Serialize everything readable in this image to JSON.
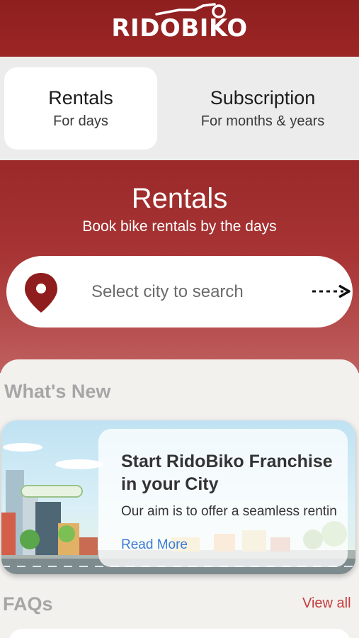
{
  "header": {
    "logo_text": "RIDOBIKO",
    "logo_icon": "motorbike-icon"
  },
  "tabs": [
    {
      "title": "Rentals",
      "subtitle": "For days",
      "active": true
    },
    {
      "title": "Subscription",
      "subtitle": "For months & years",
      "active": false
    }
  ],
  "hero": {
    "title": "Rentals",
    "subtitle": "Book bike rentals by the days",
    "search": {
      "placeholder": "Select city to search",
      "pin_icon": "location-pin-icon",
      "arrow_icon": "dashed-arrow-right-icon"
    }
  },
  "whats_new": {
    "heading": "What's New",
    "banner": {
      "title": "Start RidoBiko Franchise in your City",
      "body": "Our aim is to offer a seamless renting experience to the cus",
      "link": "Read More"
    }
  },
  "faqs": {
    "heading": "FAQs",
    "view_all": "View all"
  },
  "colors": {
    "brand": "#9b2525",
    "link": "#3a7bd5",
    "view_all": "#c43b3b"
  }
}
